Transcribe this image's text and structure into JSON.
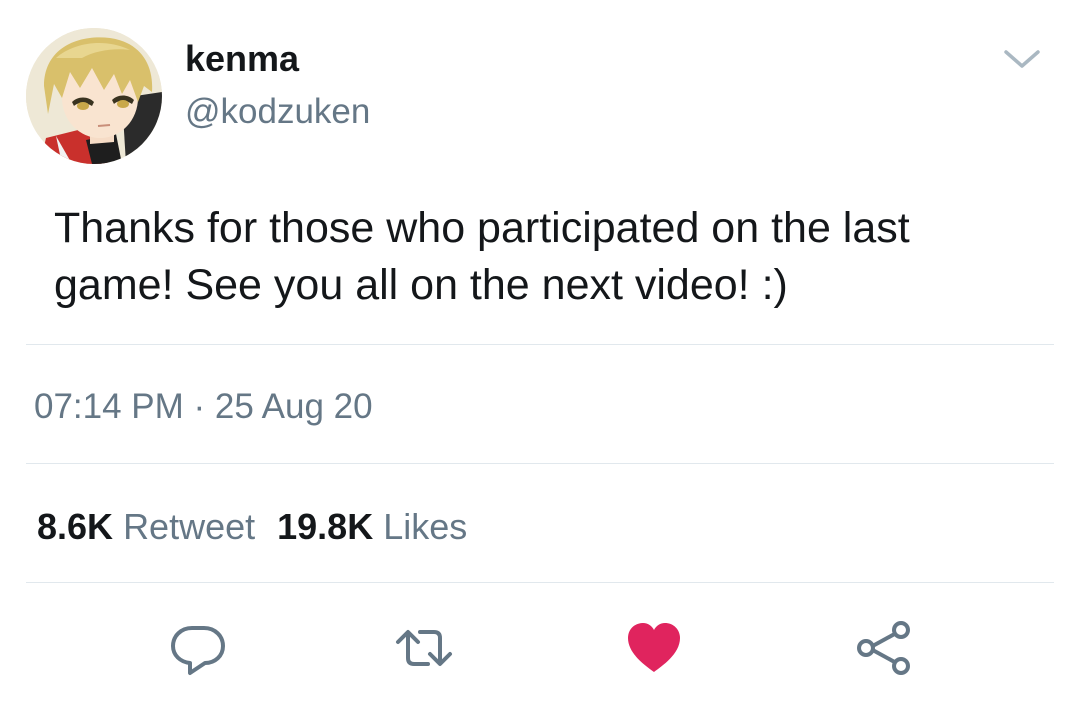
{
  "user": {
    "display_name": "kenma",
    "handle": "@kodzuken",
    "avatar_icon": "profile-avatar"
  },
  "tweet": {
    "text": "Thanks for those who participated on the last\ngame! See you all on the next video! :)",
    "timestamp": "07:14 PM · 25 Aug 20"
  },
  "stats": {
    "retweets_count": "8.6K",
    "retweets_label": "Retweet",
    "likes_count": "19.8K",
    "likes_label": "Likes"
  },
  "actions": {
    "reply_icon": "reply-icon",
    "retweet_icon": "retweet-icon",
    "like_icon": "heart-icon",
    "share_icon": "share-icon"
  },
  "colors": {
    "text_primary": "#14171a",
    "text_secondary": "#657786",
    "divider": "#e1e8ed",
    "like_red": "#e0245e"
  }
}
